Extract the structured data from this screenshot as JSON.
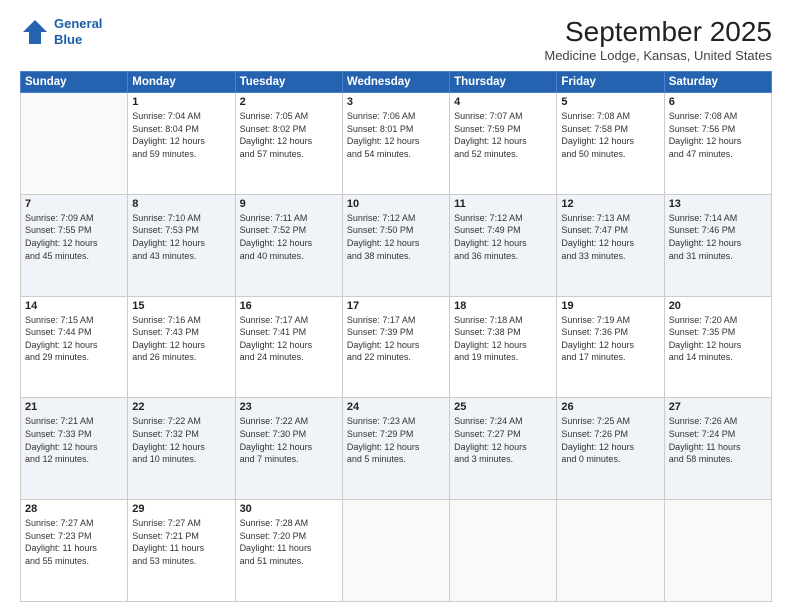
{
  "logo": {
    "line1": "General",
    "line2": "Blue"
  },
  "title": "September 2025",
  "location": "Medicine Lodge, Kansas, United States",
  "days_header": [
    "Sunday",
    "Monday",
    "Tuesday",
    "Wednesday",
    "Thursday",
    "Friday",
    "Saturday"
  ],
  "weeks": [
    [
      {
        "day": "",
        "info": ""
      },
      {
        "day": "1",
        "info": "Sunrise: 7:04 AM\nSunset: 8:04 PM\nDaylight: 12 hours\nand 59 minutes."
      },
      {
        "day": "2",
        "info": "Sunrise: 7:05 AM\nSunset: 8:02 PM\nDaylight: 12 hours\nand 57 minutes."
      },
      {
        "day": "3",
        "info": "Sunrise: 7:06 AM\nSunset: 8:01 PM\nDaylight: 12 hours\nand 54 minutes."
      },
      {
        "day": "4",
        "info": "Sunrise: 7:07 AM\nSunset: 7:59 PM\nDaylight: 12 hours\nand 52 minutes."
      },
      {
        "day": "5",
        "info": "Sunrise: 7:08 AM\nSunset: 7:58 PM\nDaylight: 12 hours\nand 50 minutes."
      },
      {
        "day": "6",
        "info": "Sunrise: 7:08 AM\nSunset: 7:56 PM\nDaylight: 12 hours\nand 47 minutes."
      }
    ],
    [
      {
        "day": "7",
        "info": "Sunrise: 7:09 AM\nSunset: 7:55 PM\nDaylight: 12 hours\nand 45 minutes."
      },
      {
        "day": "8",
        "info": "Sunrise: 7:10 AM\nSunset: 7:53 PM\nDaylight: 12 hours\nand 43 minutes."
      },
      {
        "day": "9",
        "info": "Sunrise: 7:11 AM\nSunset: 7:52 PM\nDaylight: 12 hours\nand 40 minutes."
      },
      {
        "day": "10",
        "info": "Sunrise: 7:12 AM\nSunset: 7:50 PM\nDaylight: 12 hours\nand 38 minutes."
      },
      {
        "day": "11",
        "info": "Sunrise: 7:12 AM\nSunset: 7:49 PM\nDaylight: 12 hours\nand 36 minutes."
      },
      {
        "day": "12",
        "info": "Sunrise: 7:13 AM\nSunset: 7:47 PM\nDaylight: 12 hours\nand 33 minutes."
      },
      {
        "day": "13",
        "info": "Sunrise: 7:14 AM\nSunset: 7:46 PM\nDaylight: 12 hours\nand 31 minutes."
      }
    ],
    [
      {
        "day": "14",
        "info": "Sunrise: 7:15 AM\nSunset: 7:44 PM\nDaylight: 12 hours\nand 29 minutes."
      },
      {
        "day": "15",
        "info": "Sunrise: 7:16 AM\nSunset: 7:43 PM\nDaylight: 12 hours\nand 26 minutes."
      },
      {
        "day": "16",
        "info": "Sunrise: 7:17 AM\nSunset: 7:41 PM\nDaylight: 12 hours\nand 24 minutes."
      },
      {
        "day": "17",
        "info": "Sunrise: 7:17 AM\nSunset: 7:39 PM\nDaylight: 12 hours\nand 22 minutes."
      },
      {
        "day": "18",
        "info": "Sunrise: 7:18 AM\nSunset: 7:38 PM\nDaylight: 12 hours\nand 19 minutes."
      },
      {
        "day": "19",
        "info": "Sunrise: 7:19 AM\nSunset: 7:36 PM\nDaylight: 12 hours\nand 17 minutes."
      },
      {
        "day": "20",
        "info": "Sunrise: 7:20 AM\nSunset: 7:35 PM\nDaylight: 12 hours\nand 14 minutes."
      }
    ],
    [
      {
        "day": "21",
        "info": "Sunrise: 7:21 AM\nSunset: 7:33 PM\nDaylight: 12 hours\nand 12 minutes."
      },
      {
        "day": "22",
        "info": "Sunrise: 7:22 AM\nSunset: 7:32 PM\nDaylight: 12 hours\nand 10 minutes."
      },
      {
        "day": "23",
        "info": "Sunrise: 7:22 AM\nSunset: 7:30 PM\nDaylight: 12 hours\nand 7 minutes."
      },
      {
        "day": "24",
        "info": "Sunrise: 7:23 AM\nSunset: 7:29 PM\nDaylight: 12 hours\nand 5 minutes."
      },
      {
        "day": "25",
        "info": "Sunrise: 7:24 AM\nSunset: 7:27 PM\nDaylight: 12 hours\nand 3 minutes."
      },
      {
        "day": "26",
        "info": "Sunrise: 7:25 AM\nSunset: 7:26 PM\nDaylight: 12 hours\nand 0 minutes."
      },
      {
        "day": "27",
        "info": "Sunrise: 7:26 AM\nSunset: 7:24 PM\nDaylight: 11 hours\nand 58 minutes."
      }
    ],
    [
      {
        "day": "28",
        "info": "Sunrise: 7:27 AM\nSunset: 7:23 PM\nDaylight: 11 hours\nand 55 minutes."
      },
      {
        "day": "29",
        "info": "Sunrise: 7:27 AM\nSunset: 7:21 PM\nDaylight: 11 hours\nand 53 minutes."
      },
      {
        "day": "30",
        "info": "Sunrise: 7:28 AM\nSunset: 7:20 PM\nDaylight: 11 hours\nand 51 minutes."
      },
      {
        "day": "",
        "info": ""
      },
      {
        "day": "",
        "info": ""
      },
      {
        "day": "",
        "info": ""
      },
      {
        "day": "",
        "info": ""
      }
    ]
  ]
}
